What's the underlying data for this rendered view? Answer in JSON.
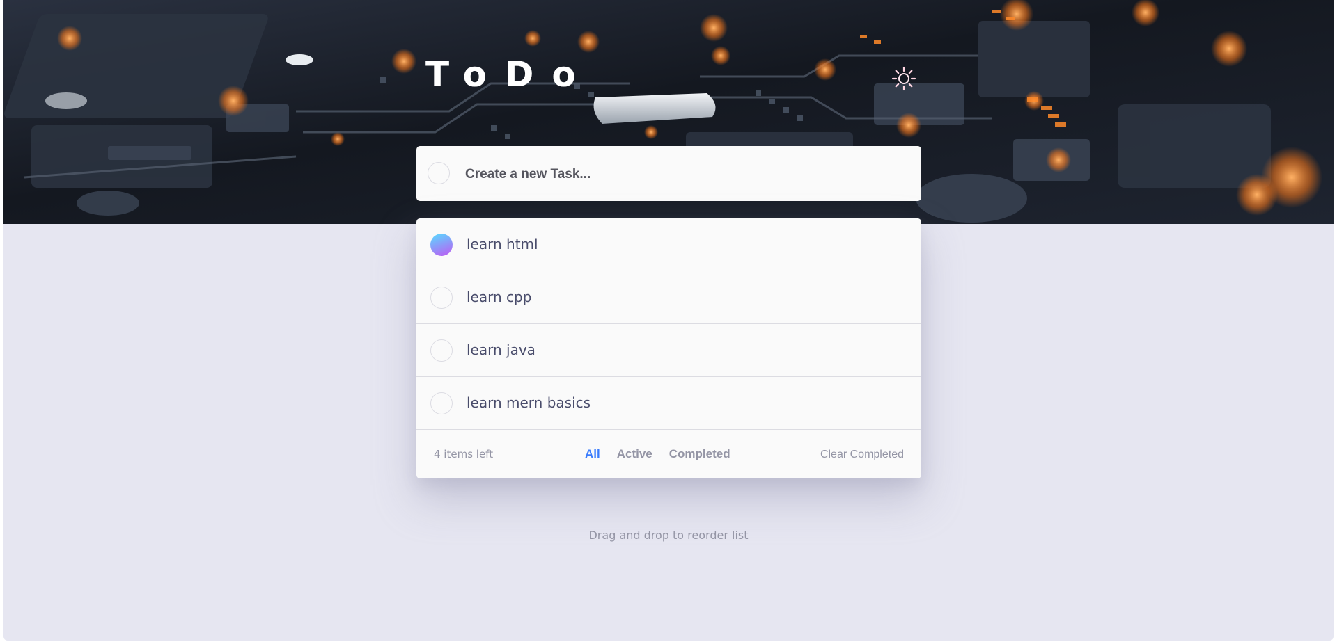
{
  "header": {
    "title": "ToDo",
    "theme_toggle_icon": "sun-icon"
  },
  "create": {
    "placeholder": "Create a new Task..."
  },
  "todos": [
    {
      "text": "learn html",
      "completed": true
    },
    {
      "text": "learn cpp",
      "completed": false
    },
    {
      "text": "learn java",
      "completed": false
    },
    {
      "text": "learn mern basics",
      "completed": false
    }
  ],
  "footer": {
    "items_left": "4 items left",
    "filters": [
      {
        "label": "All",
        "active": true
      },
      {
        "label": "Active",
        "active": false
      },
      {
        "label": "Completed",
        "active": false
      }
    ],
    "clear_label": "Clear Completed"
  },
  "hint": "Drag and drop to reorder list",
  "colors": {
    "page_bg": "#e6e6f1",
    "card_bg": "#fafafa",
    "accent": "#3a7cfd",
    "text": "#494c6b",
    "muted": "#9495a5",
    "check_gradient_start": "#57ddff",
    "check_gradient_end": "#c058f3"
  }
}
